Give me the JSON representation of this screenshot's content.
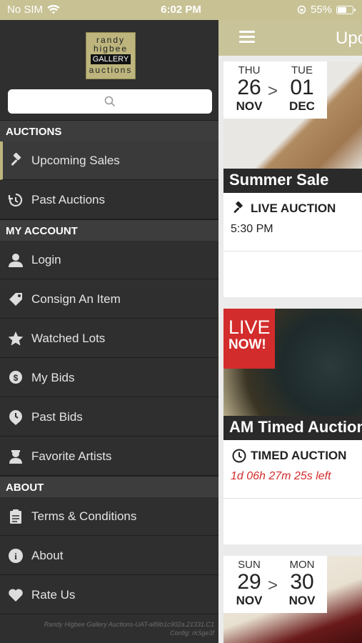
{
  "status": {
    "carrier": "No SIM",
    "time": "6:02 PM",
    "battery": "55%"
  },
  "logo": {
    "line1": "randy",
    "line2": "higbee",
    "line3": "GALLERY",
    "line4": "auctions"
  },
  "drawer": {
    "sections": {
      "auctions": "AUCTIONS",
      "my_account": "MY ACCOUNT",
      "about": "ABOUT"
    },
    "items": [
      {
        "label": "Upcoming Sales",
        "icon": "gavel-icon"
      },
      {
        "label": "Past Auctions",
        "icon": "history-icon"
      },
      {
        "label": "Login",
        "icon": "user-icon"
      },
      {
        "label": "Consign An Item",
        "icon": "tag-icon"
      },
      {
        "label": "Watched Lots",
        "icon": "star-icon"
      },
      {
        "label": "My Bids",
        "icon": "money-icon"
      },
      {
        "label": "Past Bids",
        "icon": "past-bids-icon"
      },
      {
        "label": "Favorite Artists",
        "icon": "artist-icon"
      },
      {
        "label": "Terms & Conditions",
        "icon": "document-icon"
      },
      {
        "label": "About",
        "icon": "info-icon"
      },
      {
        "label": "Rate Us",
        "icon": "heart-icon"
      }
    ],
    "footer_line1": "Randy Higbee Gallery Auctions-UAT-a89b1c902a.21331.C1",
    "footer_line2": "Config: rkSge3f"
  },
  "main": {
    "title": "Upcoming Sales",
    "cards": [
      {
        "date_start": {
          "day": "THU",
          "num": "26",
          "mon": "NOV"
        },
        "sep": ">",
        "date_end": {
          "day": "TUE",
          "num": "01",
          "mon": "DEC"
        },
        "name": "Summer Sale",
        "type": "LIVE AUCTION",
        "time": "5:30 PM"
      },
      {
        "live_line1": "LIVE",
        "live_line2": "NOW!",
        "name": "AM Timed Auction",
        "type": "TIMED AUCTION",
        "countdown": "1d 06h 27m 25s left"
      },
      {
        "date_start": {
          "day": "SUN",
          "num": "29",
          "mon": "NOV"
        },
        "sep": ">",
        "date_end": {
          "day": "MON",
          "num": "30",
          "mon": "NOV"
        }
      }
    ]
  },
  "colors": {
    "accent": "#c9c39a",
    "drawer": "#2f2f2f",
    "live": "#d32c2c",
    "countdown": "#d32c2c"
  }
}
